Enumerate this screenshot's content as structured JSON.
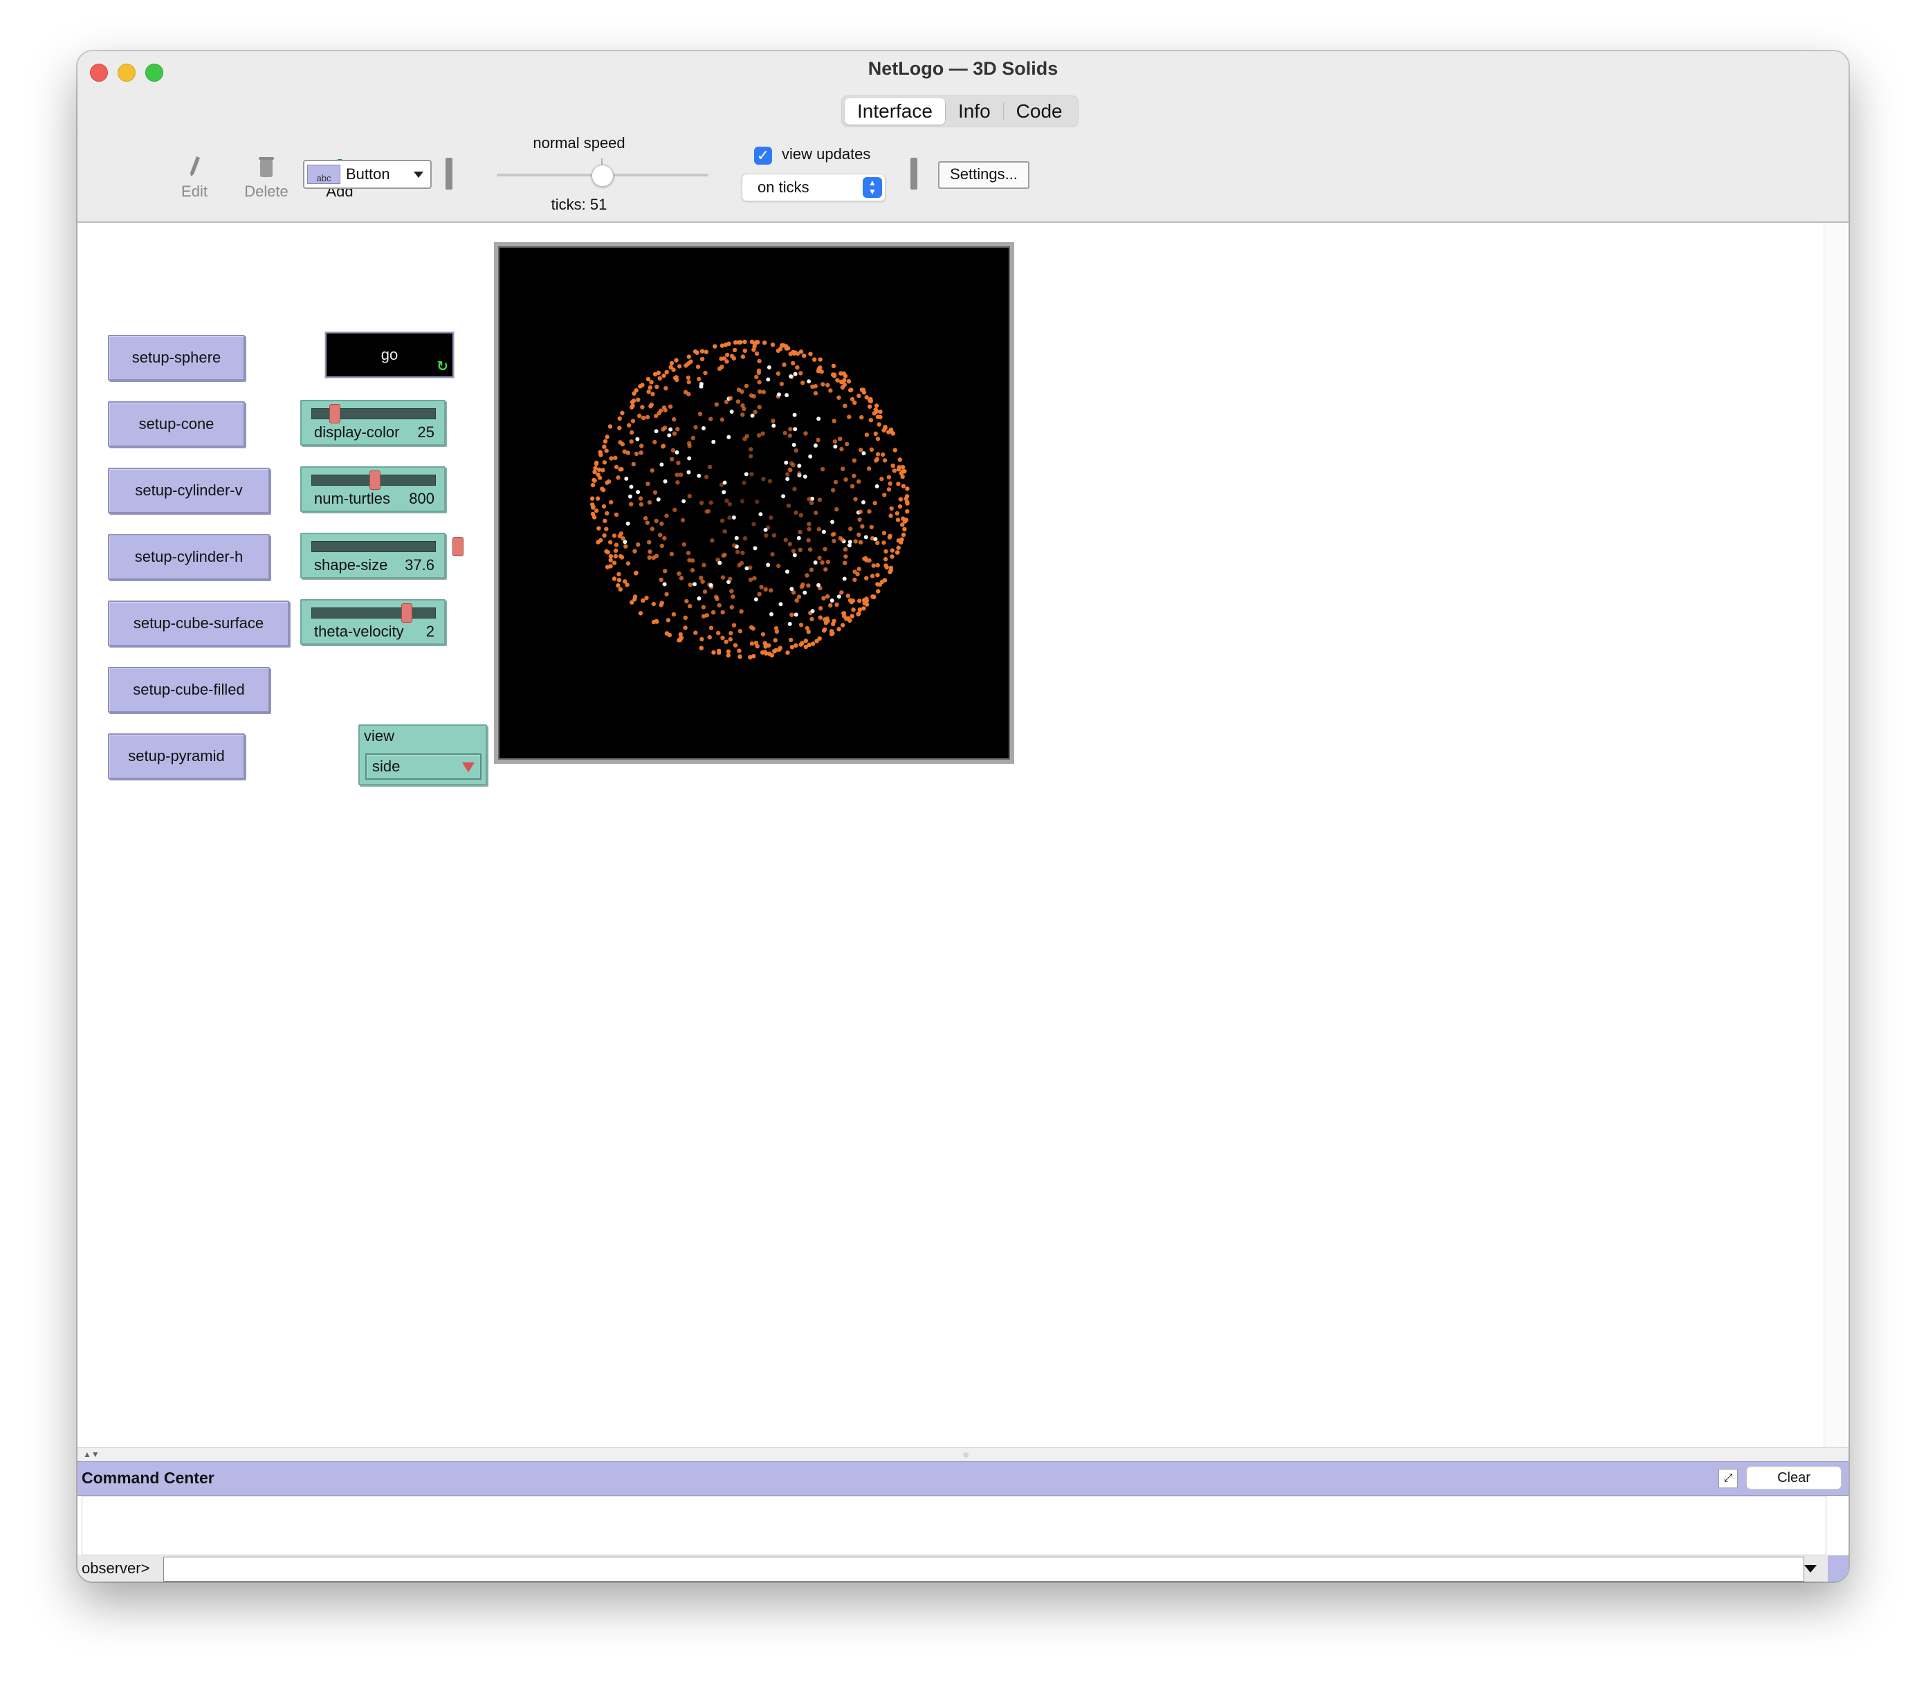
{
  "window": {
    "title": "NetLogo — 3D Solids"
  },
  "tabs": [
    {
      "label": "Interface"
    },
    {
      "label": "Info"
    },
    {
      "label": "Code"
    }
  ],
  "toolbar": {
    "edit_label": "Edit",
    "delete_label": "Delete",
    "add_label": "Add",
    "widget_type": "Button",
    "speed_label": "normal speed",
    "ticks_label": "ticks: 51",
    "view_updates_label": "view updates",
    "view_updates_checked": true,
    "update_mode": "on ticks",
    "settings_label": "Settings..."
  },
  "buttons": [
    {
      "label": "setup-sphere"
    },
    {
      "label": "setup-cone"
    },
    {
      "label": "setup-cylinder-v"
    },
    {
      "label": "setup-cylinder-h"
    },
    {
      "label": "setup-cube-surface"
    },
    {
      "label": "setup-cube-filled"
    },
    {
      "label": "setup-pyramid"
    }
  ],
  "go_button": {
    "label": "go",
    "forever": true
  },
  "sliders": [
    {
      "name": "display-color",
      "value": "25"
    },
    {
      "name": "num-turtles",
      "value": "800"
    },
    {
      "name": "shape-size",
      "value": "37.6"
    },
    {
      "name": "theta-velocity",
      "value": "2"
    }
  ],
  "chooser": {
    "label": "view",
    "value": "side"
  },
  "colors": {
    "button_bg": "#b8b8e6",
    "slider_bg": "#8fcfbf",
    "turtle_orange": "#f07a30",
    "turtle_white": "#ffffff",
    "view_bg": "#000000"
  },
  "command_center": {
    "title": "Command Center",
    "clear_label": "Clear",
    "prompt": "observer>",
    "input_value": ""
  }
}
